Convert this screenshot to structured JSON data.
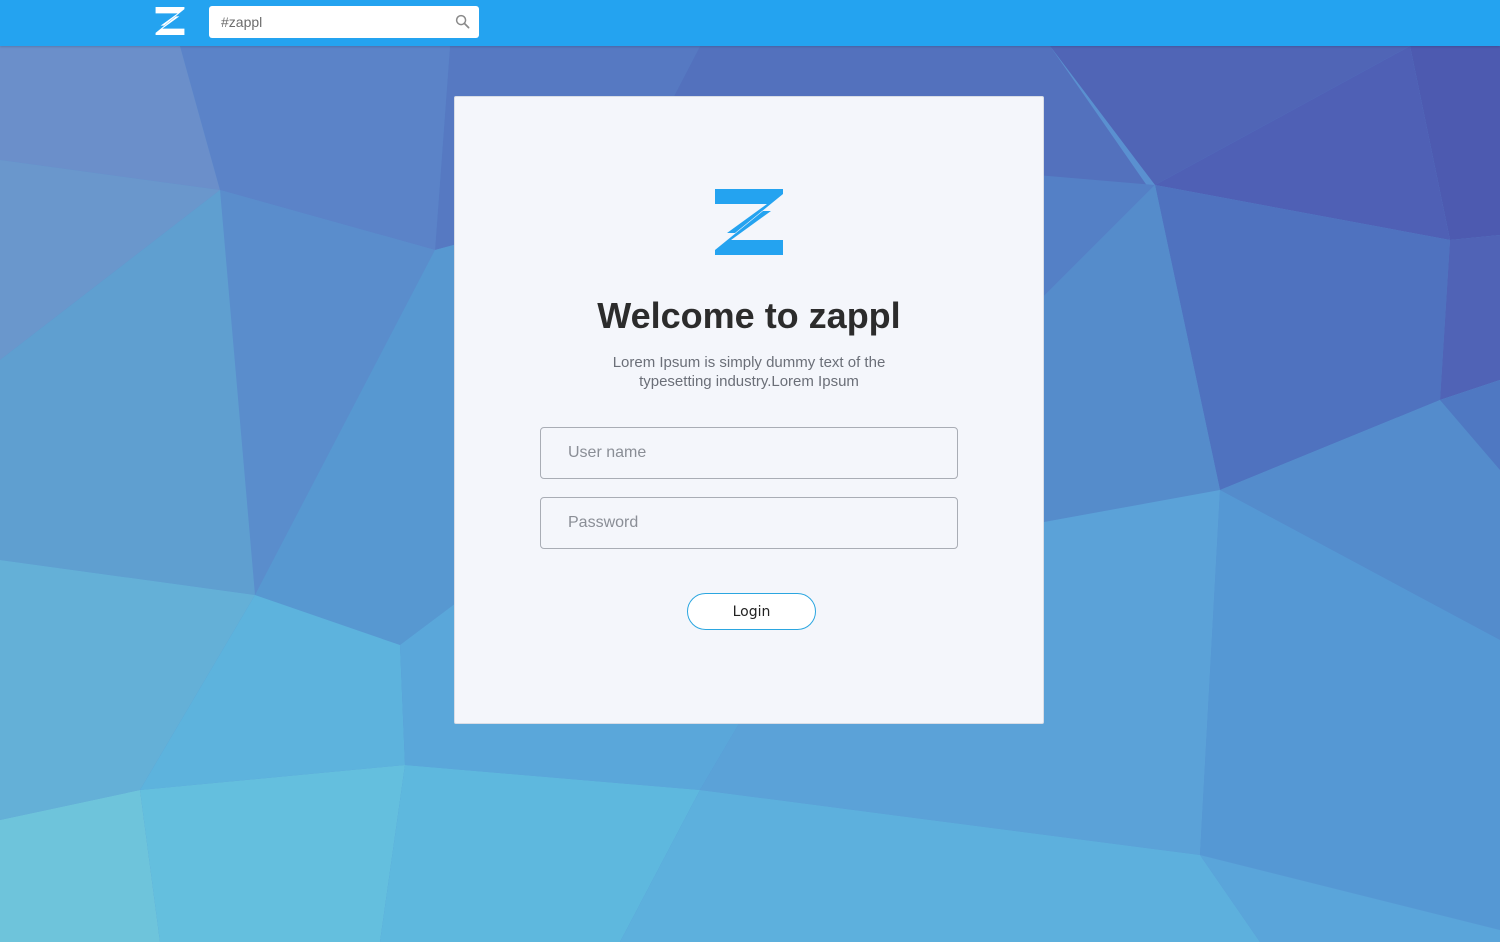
{
  "colors": {
    "header": "#24a3f0",
    "brand_blue": "#24a3f0",
    "card_background": "#f4f6fb",
    "button_border": "#2ba6e0"
  },
  "header": {
    "logo_icon": "zappl-logo-icon",
    "search": {
      "value": "",
      "placeholder": "#zappl",
      "icon": "search-icon"
    }
  },
  "login_card": {
    "logo_icon": "zappl-logo-icon",
    "title": "Welcome to zappl",
    "subtitle": "Lorem Ipsum is simply dummy text of the typesetting industry.Lorem Ipsum",
    "username": {
      "value": "",
      "placeholder": "User name"
    },
    "password": {
      "value": "",
      "placeholder": "Password"
    },
    "login_label": "Login"
  }
}
